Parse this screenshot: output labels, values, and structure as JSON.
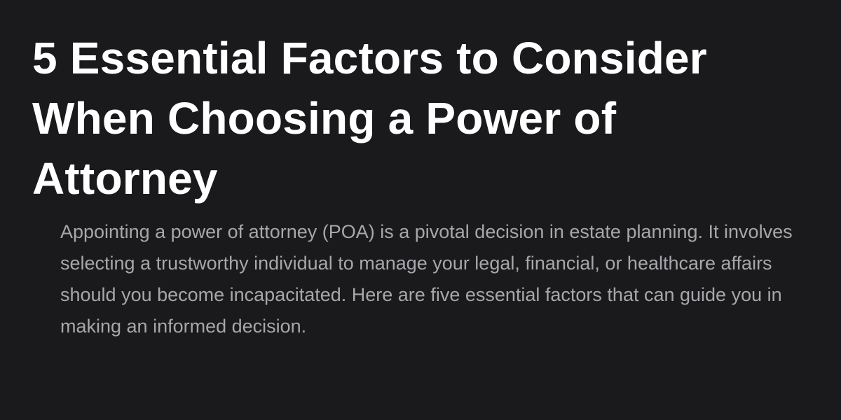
{
  "article": {
    "title": "5 Essential Factors to Consider When Choosing a Power of Attorney",
    "intro": "Appointing a power of attorney (POA) is a pivotal decision in estate planning. It involves selecting a trustworthy individual to manage your legal, financial, or healthcare affairs should you become incapacitated. Here are five essential factors that can guide you in making an informed decision."
  },
  "colors": {
    "background": "#1a1a1c",
    "title_text": "#ffffff",
    "body_text": "#a7a7ab"
  }
}
